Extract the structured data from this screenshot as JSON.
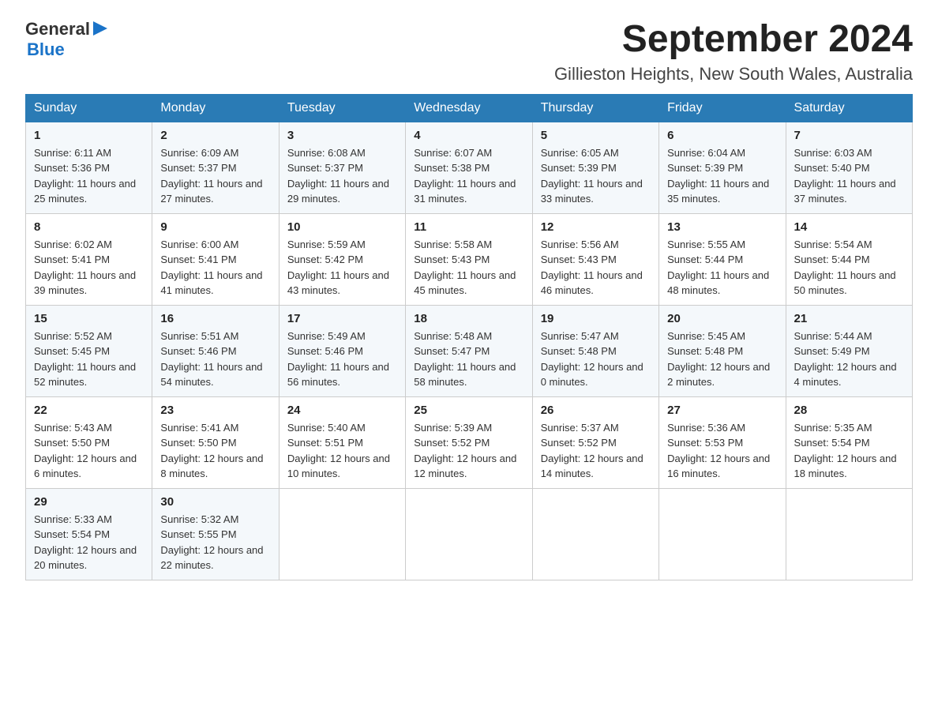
{
  "header": {
    "logo_general": "General",
    "logo_blue": "Blue",
    "title": "September 2024",
    "subtitle": "Gillieston Heights, New South Wales, Australia"
  },
  "days": [
    "Sunday",
    "Monday",
    "Tuesday",
    "Wednesday",
    "Thursday",
    "Friday",
    "Saturday"
  ],
  "weeks": [
    [
      {
        "day": "1",
        "sunrise": "6:11 AM",
        "sunset": "5:36 PM",
        "daylight": "11 hours and 25 minutes."
      },
      {
        "day": "2",
        "sunrise": "6:09 AM",
        "sunset": "5:37 PM",
        "daylight": "11 hours and 27 minutes."
      },
      {
        "day": "3",
        "sunrise": "6:08 AM",
        "sunset": "5:37 PM",
        "daylight": "11 hours and 29 minutes."
      },
      {
        "day": "4",
        "sunrise": "6:07 AM",
        "sunset": "5:38 PM",
        "daylight": "11 hours and 31 minutes."
      },
      {
        "day": "5",
        "sunrise": "6:05 AM",
        "sunset": "5:39 PM",
        "daylight": "11 hours and 33 minutes."
      },
      {
        "day": "6",
        "sunrise": "6:04 AM",
        "sunset": "5:39 PM",
        "daylight": "11 hours and 35 minutes."
      },
      {
        "day": "7",
        "sunrise": "6:03 AM",
        "sunset": "5:40 PM",
        "daylight": "11 hours and 37 minutes."
      }
    ],
    [
      {
        "day": "8",
        "sunrise": "6:02 AM",
        "sunset": "5:41 PM",
        "daylight": "11 hours and 39 minutes."
      },
      {
        "day": "9",
        "sunrise": "6:00 AM",
        "sunset": "5:41 PM",
        "daylight": "11 hours and 41 minutes."
      },
      {
        "day": "10",
        "sunrise": "5:59 AM",
        "sunset": "5:42 PM",
        "daylight": "11 hours and 43 minutes."
      },
      {
        "day": "11",
        "sunrise": "5:58 AM",
        "sunset": "5:43 PM",
        "daylight": "11 hours and 45 minutes."
      },
      {
        "day": "12",
        "sunrise": "5:56 AM",
        "sunset": "5:43 PM",
        "daylight": "11 hours and 46 minutes."
      },
      {
        "day": "13",
        "sunrise": "5:55 AM",
        "sunset": "5:44 PM",
        "daylight": "11 hours and 48 minutes."
      },
      {
        "day": "14",
        "sunrise": "5:54 AM",
        "sunset": "5:44 PM",
        "daylight": "11 hours and 50 minutes."
      }
    ],
    [
      {
        "day": "15",
        "sunrise": "5:52 AM",
        "sunset": "5:45 PM",
        "daylight": "11 hours and 52 minutes."
      },
      {
        "day": "16",
        "sunrise": "5:51 AM",
        "sunset": "5:46 PM",
        "daylight": "11 hours and 54 minutes."
      },
      {
        "day": "17",
        "sunrise": "5:49 AM",
        "sunset": "5:46 PM",
        "daylight": "11 hours and 56 minutes."
      },
      {
        "day": "18",
        "sunrise": "5:48 AM",
        "sunset": "5:47 PM",
        "daylight": "11 hours and 58 minutes."
      },
      {
        "day": "19",
        "sunrise": "5:47 AM",
        "sunset": "5:48 PM",
        "daylight": "12 hours and 0 minutes."
      },
      {
        "day": "20",
        "sunrise": "5:45 AM",
        "sunset": "5:48 PM",
        "daylight": "12 hours and 2 minutes."
      },
      {
        "day": "21",
        "sunrise": "5:44 AM",
        "sunset": "5:49 PM",
        "daylight": "12 hours and 4 minutes."
      }
    ],
    [
      {
        "day": "22",
        "sunrise": "5:43 AM",
        "sunset": "5:50 PM",
        "daylight": "12 hours and 6 minutes."
      },
      {
        "day": "23",
        "sunrise": "5:41 AM",
        "sunset": "5:50 PM",
        "daylight": "12 hours and 8 minutes."
      },
      {
        "day": "24",
        "sunrise": "5:40 AM",
        "sunset": "5:51 PM",
        "daylight": "12 hours and 10 minutes."
      },
      {
        "day": "25",
        "sunrise": "5:39 AM",
        "sunset": "5:52 PM",
        "daylight": "12 hours and 12 minutes."
      },
      {
        "day": "26",
        "sunrise": "5:37 AM",
        "sunset": "5:52 PM",
        "daylight": "12 hours and 14 minutes."
      },
      {
        "day": "27",
        "sunrise": "5:36 AM",
        "sunset": "5:53 PM",
        "daylight": "12 hours and 16 minutes."
      },
      {
        "day": "28",
        "sunrise": "5:35 AM",
        "sunset": "5:54 PM",
        "daylight": "12 hours and 18 minutes."
      }
    ],
    [
      {
        "day": "29",
        "sunrise": "5:33 AM",
        "sunset": "5:54 PM",
        "daylight": "12 hours and 20 minutes."
      },
      {
        "day": "30",
        "sunrise": "5:32 AM",
        "sunset": "5:55 PM",
        "daylight": "12 hours and 22 minutes."
      },
      null,
      null,
      null,
      null,
      null
    ]
  ],
  "labels": {
    "sunrise": "Sunrise:",
    "sunset": "Sunset:",
    "daylight": "Daylight:"
  }
}
